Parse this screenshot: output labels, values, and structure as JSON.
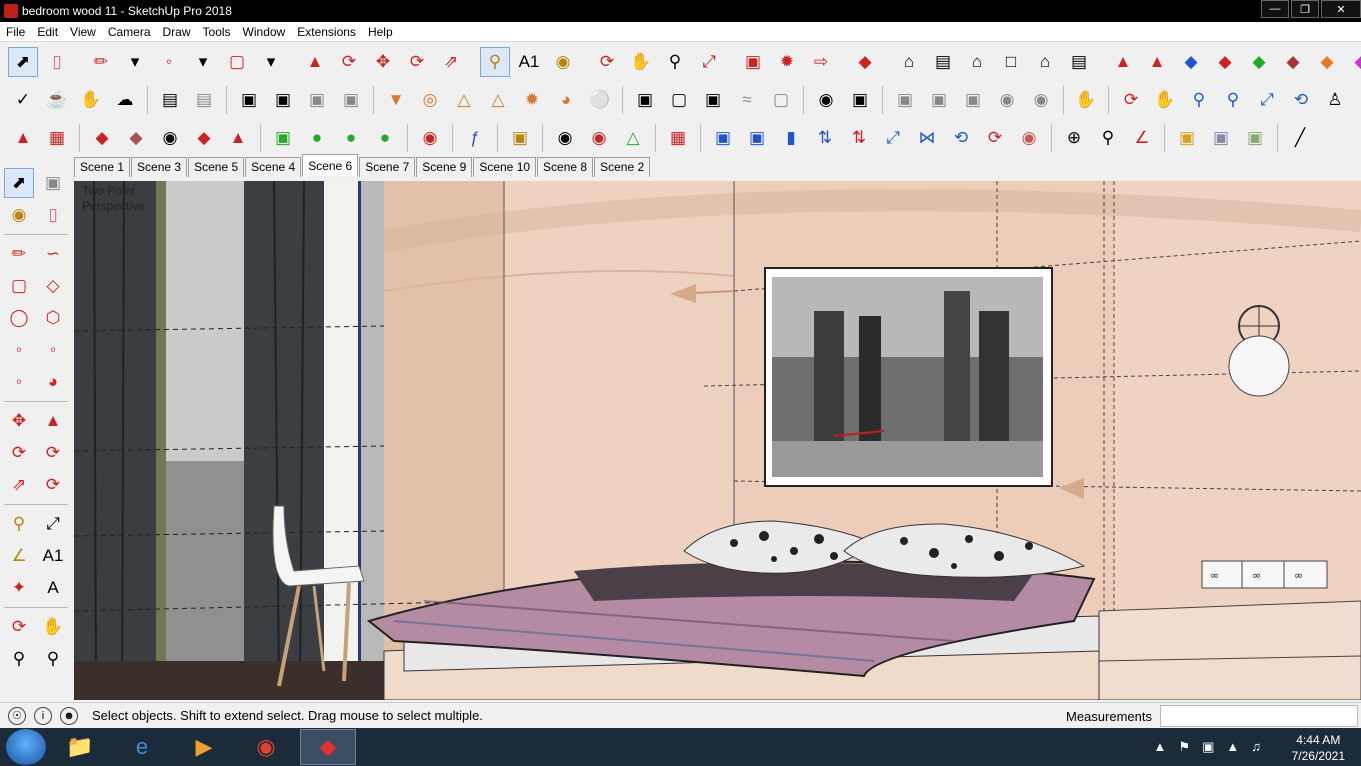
{
  "window": {
    "title": "bedroom wood 11 - SketchUp Pro 2018"
  },
  "menu": [
    "File",
    "Edit",
    "View",
    "Camera",
    "Draw",
    "Tools",
    "Window",
    "Extensions",
    "Help"
  ],
  "scenes": [
    "Scene 1",
    "Scene 3",
    "Scene 5",
    "Scene 4",
    "Scene 6",
    "Scene 7",
    "Scene 9",
    "Scene 10",
    "Scene 8",
    "Scene 2"
  ],
  "active_scene": "Scene 6",
  "viewport": {
    "label_line1": "Two Point",
    "label_line2": "Perspective"
  },
  "status": {
    "hint": "Select objects. Shift to extend select. Drag mouse to select multiple.",
    "measurements_label": "Measurements",
    "measurements_value": ""
  },
  "clock": {
    "time": "4:44 AM",
    "date": "7/26/2021"
  },
  "colors": {
    "wall": "#e9cbb8",
    "titlebar": "#000000",
    "taskbar": "#1c2b3a"
  }
}
